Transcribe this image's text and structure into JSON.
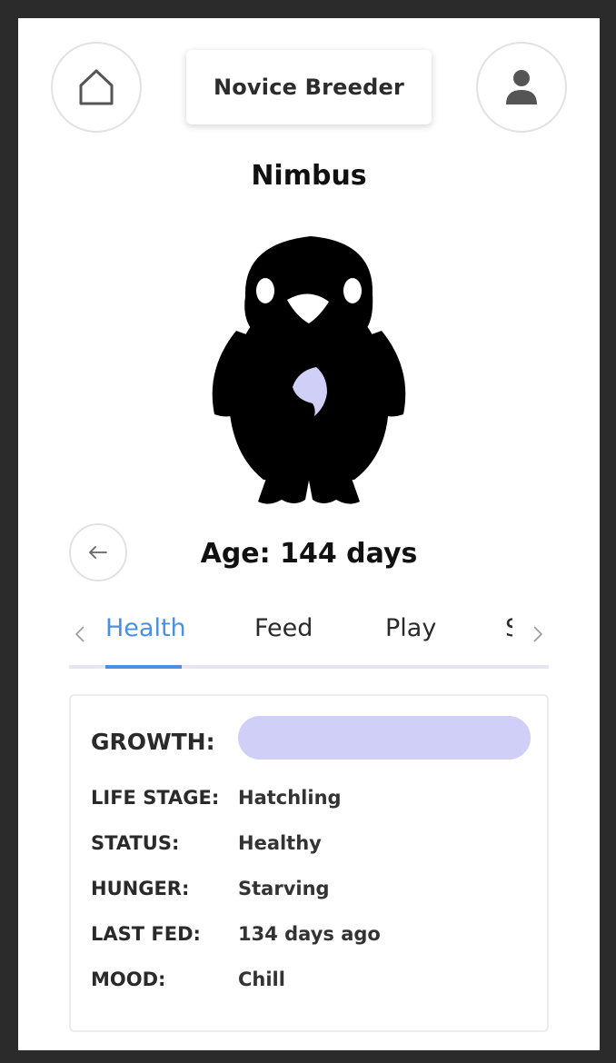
{
  "header": {
    "rank": "Novice Breeder",
    "home_icon": "home-icon",
    "profile_icon": "user-icon"
  },
  "pet": {
    "name": "Nimbus",
    "age_text": "Age: 144 days",
    "silhouette_color": "#000000",
    "gem_color": "#cfcff8"
  },
  "tabs": {
    "items": [
      {
        "label": "Health",
        "active": true
      },
      {
        "label": "Feed",
        "active": false
      },
      {
        "label": "Play",
        "active": false
      },
      {
        "label": "S",
        "active": false
      }
    ],
    "accent": "#4a90e2"
  },
  "stats": {
    "growth_label": "GROWTH:",
    "growth_progress": 1.0,
    "rows": [
      {
        "key": "LIFE STAGE:",
        "value": "Hatchling"
      },
      {
        "key": "STATUS:",
        "value": "Healthy"
      },
      {
        "key": "HUNGER:",
        "value": "Starving"
      },
      {
        "key": "LAST FED:",
        "value": "134 days ago"
      },
      {
        "key": "MOOD:",
        "value": "Chill"
      }
    ]
  }
}
